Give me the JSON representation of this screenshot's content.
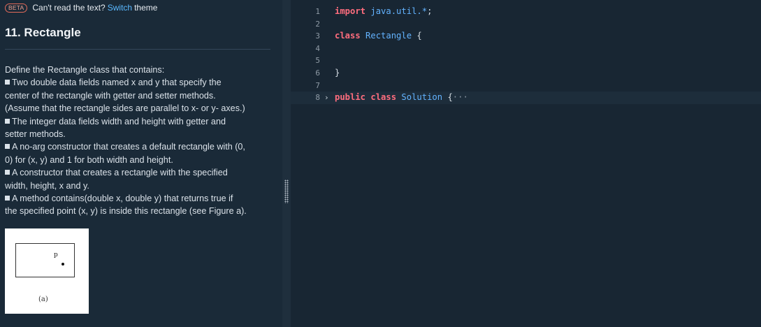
{
  "banner": {
    "beta": "BETA",
    "prefix": "Can't read the text?",
    "link": "Switch",
    "suffix": "theme"
  },
  "problem": {
    "title": "11. Rectangle",
    "intro": "Define the Rectangle class that contains:",
    "bullets": [
      [
        "Two double data fields named x and y that specify the",
        "center of the rectangle with getter and setter methods.",
        "(Assume that the rectangle sides are parallel to x- or y- axes.)"
      ],
      [
        "The integer data fields width and height with getter and",
        "setter methods."
      ],
      [
        "A no-arg constructor that creates a default rectangle with (0,",
        "0) for (x, y) and 1 for both width and height."
      ],
      [
        "A constructor that creates a rectangle with the specified",
        "width, height, x and y."
      ],
      [
        "A method contains(double x, double y) that returns true if",
        "the specified point (x, y) is inside this rectangle (see Figure a)."
      ]
    ],
    "figure": {
      "point_label": "p",
      "caption": "(a)"
    }
  },
  "editor": {
    "lines": [
      {
        "n": "1",
        "tokens": [
          [
            "kw",
            "import"
          ],
          [
            "pl",
            " "
          ],
          [
            "ty",
            "java.util.*"
          ],
          [
            "pl",
            ";"
          ]
        ]
      },
      {
        "n": "2",
        "tokens": []
      },
      {
        "n": "3",
        "tokens": [
          [
            "kw",
            "class"
          ],
          [
            "pl",
            " "
          ],
          [
            "ty",
            "Rectangle"
          ],
          [
            "pl",
            " {"
          ]
        ]
      },
      {
        "n": "4",
        "tokens": []
      },
      {
        "n": "5",
        "tokens": []
      },
      {
        "n": "6",
        "tokens": [
          [
            "pl",
            "}"
          ]
        ]
      },
      {
        "n": "7",
        "tokens": []
      },
      {
        "n": "8",
        "fold": "›",
        "tokens": [
          [
            "kw",
            "public"
          ],
          [
            "pl",
            " "
          ],
          [
            "kw",
            "class"
          ],
          [
            "pl",
            " "
          ],
          [
            "ty",
            "Solution"
          ],
          [
            "pl",
            " {"
          ],
          [
            "el",
            "···"
          ]
        ]
      }
    ]
  }
}
